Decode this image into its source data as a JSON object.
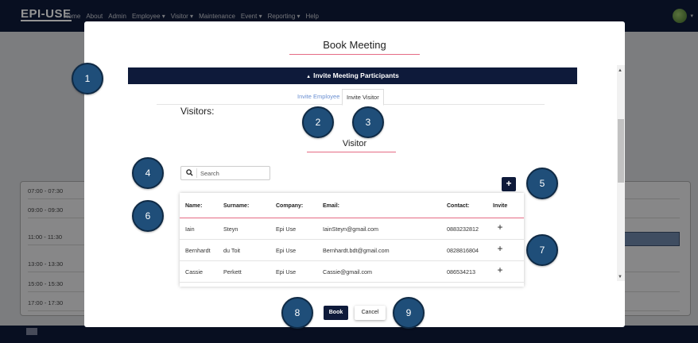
{
  "navbar": {
    "brand": "EPI-USE",
    "menu": [
      "Home",
      "About",
      "Admin",
      "Employee ▾",
      "Visitor ▾",
      "Maintenance",
      "Event ▾",
      "Reporting ▾",
      "Help"
    ]
  },
  "schedule": {
    "slots": [
      "07:00 - 07:30",
      "09:00 - 09:30",
      "11:00 - 11:30",
      "13:00 - 13:30",
      "15:00 - 15:30",
      "17:00 - 17:30"
    ]
  },
  "modal": {
    "title": "Book Meeting",
    "section_title": "Invite Meeting Participants",
    "tabs": [
      "Invite Employee",
      "Invite Visitor"
    ],
    "visitors_label": "Visitors:",
    "visitor_heading": "Visitor",
    "search_placeholder": "Search",
    "add_label": "+",
    "table": {
      "headers": [
        "Name:",
        "Surname:",
        "Company:",
        "Email:",
        "Contact:",
        "Invite"
      ],
      "rows": [
        {
          "name": "Iain",
          "surname": "Steyn",
          "company": "Epi Use",
          "email": "IainSteyn@gmail.com",
          "contact": "0883232812",
          "invite": "+"
        },
        {
          "name": "Bernhardt",
          "surname": "du Toit",
          "company": "Epi Use",
          "email": "Bernhardt.bdt@gmail.com",
          "contact": "0828816804",
          "invite": "+"
        },
        {
          "name": "Cassie",
          "surname": "Perkett",
          "company": "Epi Use",
          "email": "Cassie@gmail.com",
          "contact": "086534213",
          "invite": "+"
        }
      ]
    },
    "book_label": "Book",
    "cancel_label": "Cancel"
  },
  "callouts": [
    "1",
    "2",
    "3",
    "4",
    "5",
    "6",
    "7",
    "8",
    "9"
  ],
  "colors": {
    "navy": "#0e1a3a",
    "accent_pink": "#e56b84",
    "callout_blue": "#1f4e79",
    "tab_link_blue": "#6a8fd1"
  },
  "icons": {
    "search": "search-icon",
    "collapse": "caret-up-icon",
    "add": "plus-icon"
  }
}
